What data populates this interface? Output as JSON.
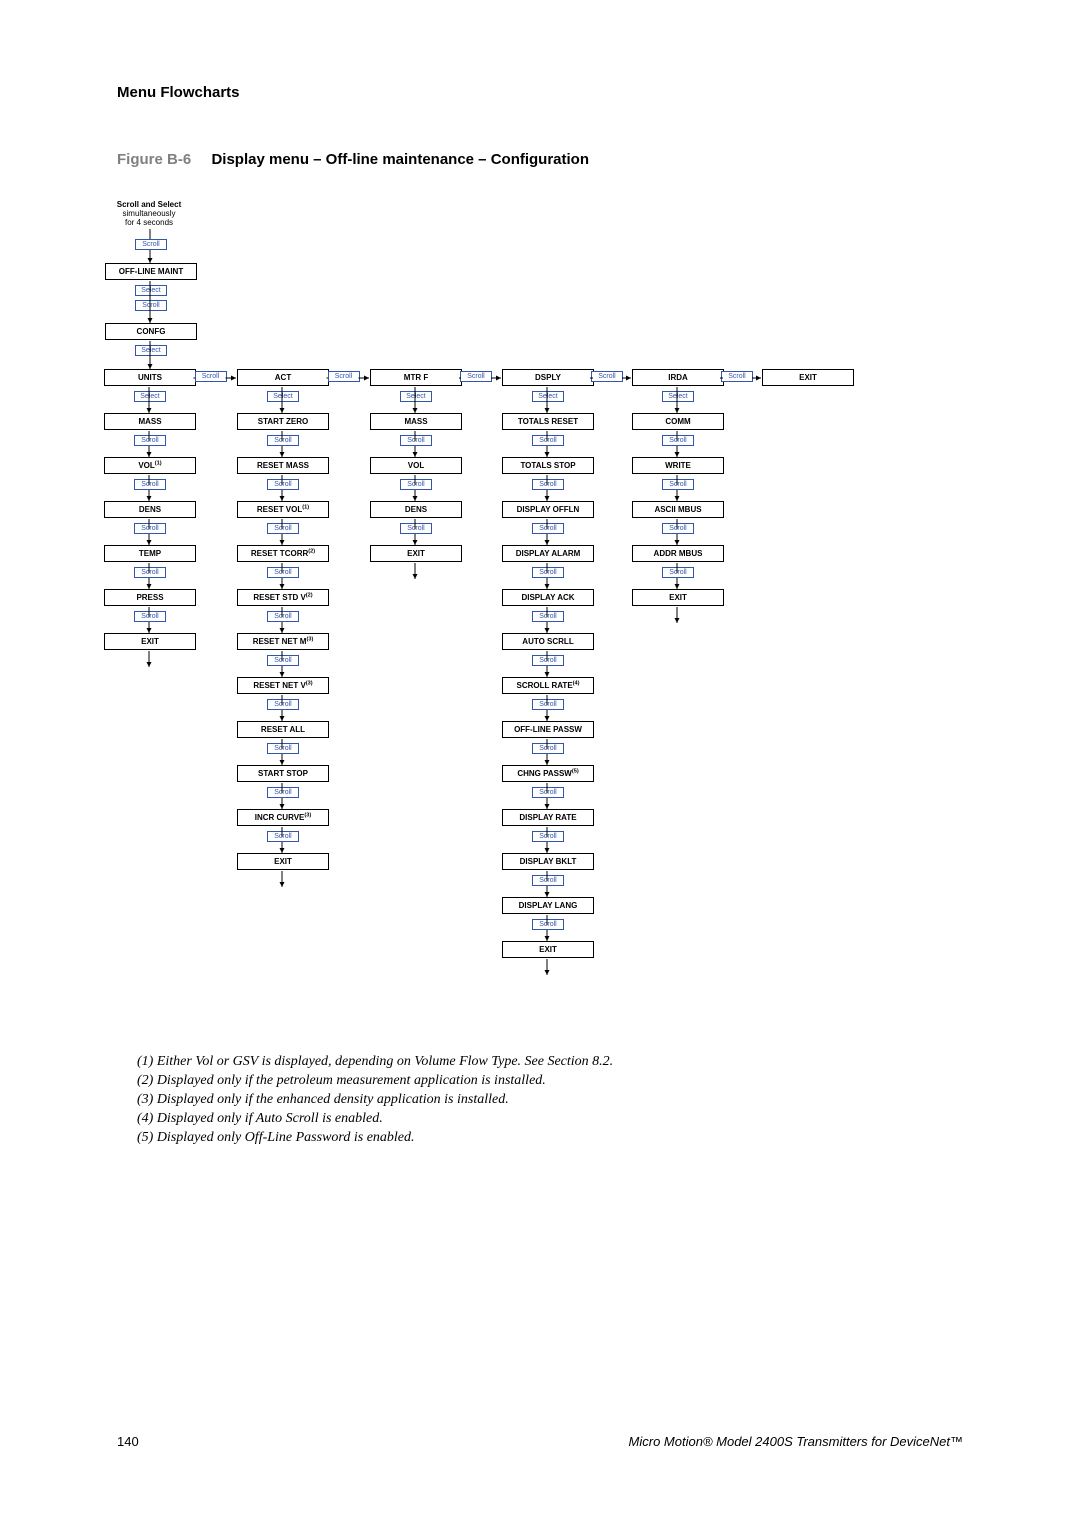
{
  "header": {
    "section": "Menu Flowcharts",
    "figure_num": "Figure B-6",
    "figure_title": "Display menu – Off-line maintenance – Configuration"
  },
  "entry": {
    "line1": "Scroll and Select",
    "line2": "simultaneously",
    "line3": "for 4 seconds",
    "scroll": "Scroll",
    "select": "Select"
  },
  "pre": {
    "offline_maint": "OFF-LINE MAINT",
    "confg": "CONFG"
  },
  "button": {
    "scroll": "Scroll",
    "select": "Select"
  },
  "categories": {
    "units": "UNITS",
    "act": "ACT",
    "mtrf": "MTR F",
    "dsply": "DSPLY",
    "irda": "IRDA",
    "exit": "EXIT"
  },
  "units": {
    "mass": "MASS",
    "vol": "VOL",
    "dens": "DENS",
    "temp": "TEMP",
    "press": "PRESS",
    "exit": "EXIT",
    "sup1": "(1)"
  },
  "act": {
    "start_zero": "START ZERO",
    "reset_mass": "RESET MASS",
    "reset_vol": "RESET VOL",
    "reset_tcorr": "RESET TCORR",
    "reset_stdv": "RESET STD V",
    "reset_netm": "RESET NET M",
    "reset_netv": "RESET NET V",
    "reset_all": "RESET ALL",
    "start_stop": "START STOP",
    "incr_curve": "INCR CURVE",
    "exit": "EXIT",
    "sup1": "(1)",
    "sup2": "(2)",
    "sup3": "(3)"
  },
  "mtrf": {
    "mass": "MASS",
    "vol": "VOL",
    "dens": "DENS",
    "exit": "EXIT"
  },
  "dsply": {
    "totals_reset": "TOTALS RESET",
    "totals_stop": "TOTALS STOP",
    "display_offln": "DISPLAY OFFLN",
    "display_alarm": "DISPLAY ALARM",
    "display_ack": "DISPLAY ACK",
    "auto_scrll": "AUTO SCRLL",
    "scroll_rate": "SCROLL RATE",
    "offline_passw": "OFF-LINE PASSW",
    "chng_passw": "CHNG PASSW",
    "display_rate": "DISPLAY RATE",
    "display_bklt": "DISPLAY BKLT",
    "display_lang": "DISPLAY LANG",
    "exit": "EXIT",
    "sup4": "(4)",
    "sup5": "(5)"
  },
  "irda": {
    "comm": "COMM",
    "write": "WRITE",
    "ascii_mbus": "ASCII MBUS",
    "addr_mbus": "ADDR MBUS",
    "exit": "EXIT"
  },
  "notes": {
    "n1": "(1) Either Vol or GSV is displayed, depending on Volume Flow Type. See Section 8.2.",
    "n2": "(2) Displayed only if the petroleum measurement application is installed.",
    "n3": "(3) Displayed only if the enhanced density application is installed.",
    "n4": "(4) Displayed only if Auto Scroll is enabled.",
    "n5": "(5) Displayed only Off-Line Password is enabled."
  },
  "footer": {
    "page": "140",
    "text": "Micro Motion® Model 2400S Transmitters for DeviceNet™"
  }
}
